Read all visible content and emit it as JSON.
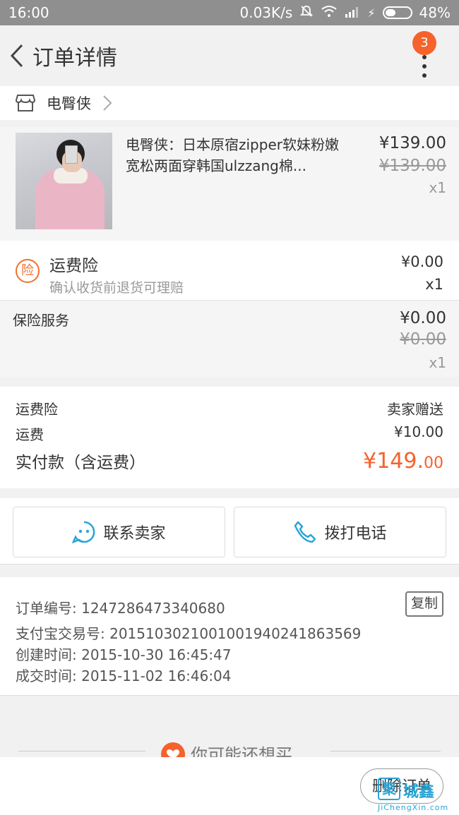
{
  "status_bar": {
    "time": "16:00",
    "network_speed": "0.03K/s",
    "battery": "48%",
    "battery_level": 0.48
  },
  "nav": {
    "title": "订单详情",
    "badge": "3"
  },
  "shop": {
    "name": "电臀侠"
  },
  "item": {
    "title": "电臀侠：日本原宿zipper软妹粉嫩宽松两面穿韩国ulzzang棉...",
    "price": "¥139.00",
    "original_price": "¥139.00",
    "quantity": "x1"
  },
  "freight_insurance": {
    "icon_text": "险",
    "title": "运费险",
    "subtitle": "确认收货前退货可理赔",
    "price": "¥0.00",
    "quantity": "x1"
  },
  "insurance_service": {
    "title": "保险服务",
    "price": "¥0.00",
    "original_price": "¥0.00",
    "quantity": "x1"
  },
  "summary": {
    "freight_insurance_label": "运费险",
    "freight_insurance_value": "卖家赠送",
    "shipping_label": "运费",
    "shipping_value": "¥10.00",
    "total_label": "实付款（含运费）",
    "total_main": "¥149.",
    "total_decimal": "00"
  },
  "actions": {
    "contact_label": "联系卖家",
    "call_label": "拨打电话"
  },
  "order_info": {
    "order_no": "订单编号: 1247286473340680",
    "alipay_no": "支付宝交易号: 2015103021001001940241863569",
    "created": "创建时间: 2015-10-30 16:45:47",
    "completed": "成交时间: 2015-11-02 16:46:04",
    "copy_label": "复制"
  },
  "recommend": {
    "title": "你可能还想买"
  },
  "bottom": {
    "delete_label": "删除订单"
  },
  "watermark": {
    "box": "聚",
    "cn": "城鑫",
    "en": "JiChengXin.com"
  },
  "colors": {
    "accent": "#f5622b",
    "icon_blue": "#29a5d6",
    "status_bar": "#8f8f8f"
  }
}
